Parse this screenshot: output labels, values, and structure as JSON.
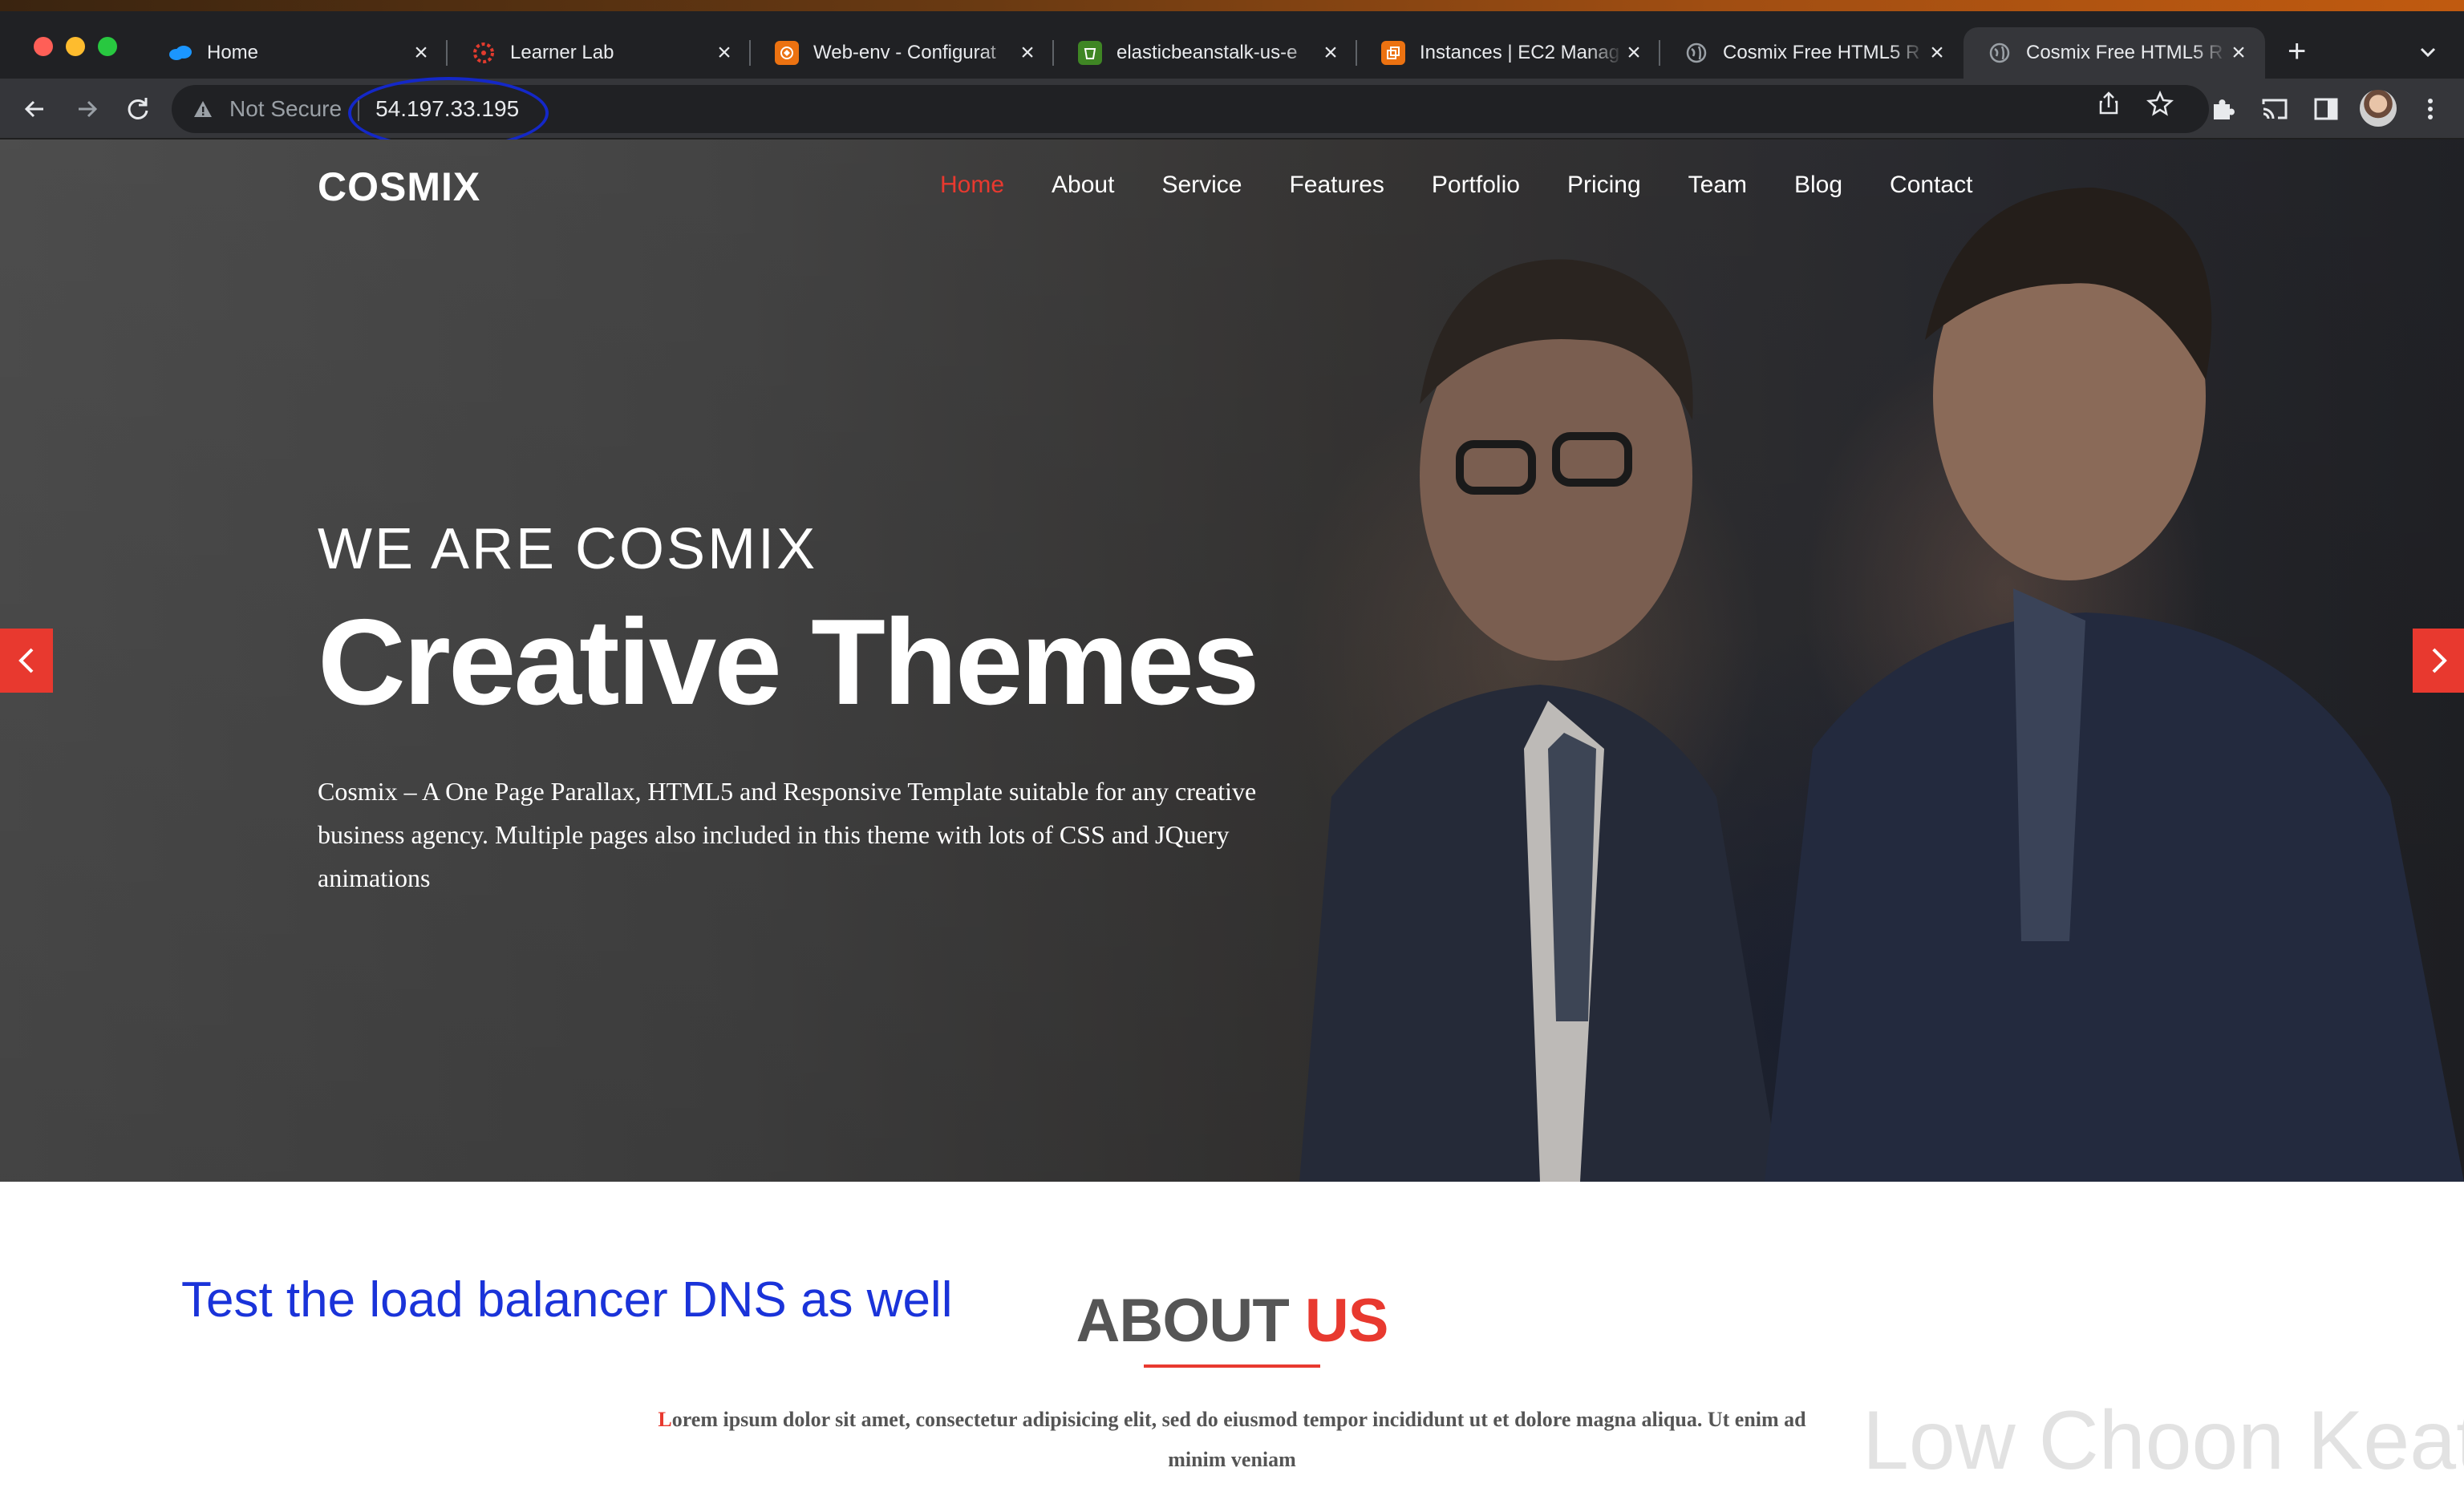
{
  "browser": {
    "tabs": [
      {
        "label": "Home",
        "icon": "salesforce-cloud-icon",
        "color": "#1b96ff"
      },
      {
        "label": "Learner Lab",
        "icon": "canvas-icon",
        "color": "#e13b2e"
      },
      {
        "label": "Web-env - Configurat",
        "icon": "elastic-beanstalk-icon",
        "color": "#ec7211"
      },
      {
        "label": "elasticbeanstalk-us-e",
        "icon": "s3-bucket-icon",
        "color": "#3f8624"
      },
      {
        "label": "Instances | EC2 Manag",
        "icon": "ec2-icon",
        "color": "#ec7211"
      },
      {
        "label": "Cosmix Free HTML5 R",
        "icon": "globe-icon",
        "color": "#9aa0a6"
      },
      {
        "label": "Cosmix Free HTML5 R",
        "icon": "globe-icon",
        "color": "#9aa0a6"
      }
    ],
    "active_tab": 6,
    "address": {
      "security_label": "Not Secure",
      "url": "54.197.33.195"
    }
  },
  "site": {
    "logo": "COSMIX",
    "nav": [
      "Home",
      "About",
      "Service",
      "Features",
      "Portfolio",
      "Pricing",
      "Team",
      "Blog",
      "Contact"
    ],
    "active_nav": "Home",
    "accent_color": "#e8392f",
    "hero": {
      "kicker": "WE ARE COSMIX",
      "title": "Creative Themes",
      "description": "Cosmix – A One Page Parallax, HTML5 and Responsive Template suitable for any creative business agency. Multiple pages also included in this theme with lots of CSS and JQuery animations"
    },
    "about": {
      "title_main": "ABOUT",
      "title_accent": "US",
      "body_initial": "L",
      "body_rest": "orem ipsum dolor sit amet, consectetur adipisicing elit, sed do eiusmod tempor incididunt ut et dolore magna aliqua. Ut enim ad minim veniam"
    }
  },
  "annotations": {
    "note": "Test the load balancer DNS as well",
    "note_color": "#1a33d9",
    "watermark": "Low Choon Keat"
  }
}
